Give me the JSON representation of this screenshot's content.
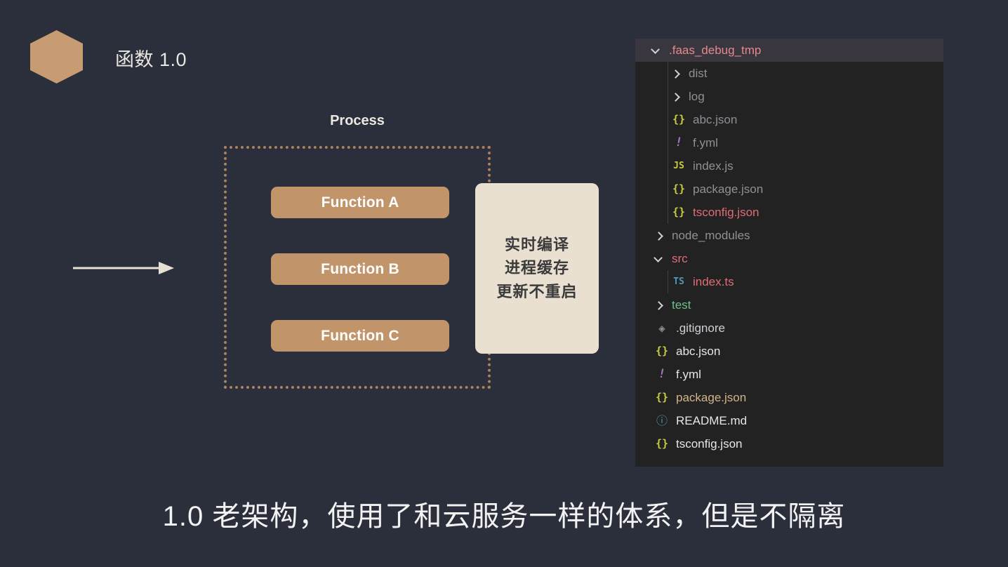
{
  "slide": {
    "title": "函数 1.0",
    "caption": "1.0 老架构，使用了和云服务一样的体系，但是不隔离",
    "background_color": "#2b2e3b",
    "accent_color": "#c79c72"
  },
  "diagram": {
    "process_label": "Process",
    "arrow_name": "right-arrow",
    "functions": [
      {
        "label": "Function A"
      },
      {
        "label": "Function B"
      },
      {
        "label": "Function C"
      }
    ],
    "feature_card": {
      "lines": [
        "实时编译",
        "进程缓存",
        "更新不重启"
      ],
      "background_color": "#e9e0d1"
    },
    "box_border_color": "#a9815a"
  },
  "file_tree": {
    "panel_background": "#222222",
    "header_background": "#3a3640",
    "rows": [
      {
        "label": ".faas_debug_tmp",
        "icon": "chevron-down-icon",
        "indent": 0,
        "color": "red",
        "header": true,
        "guide": false
      },
      {
        "label": "dist",
        "icon": "chevron-right-icon",
        "indent": 1,
        "color": "dim",
        "header": false,
        "guide": true
      },
      {
        "label": "log",
        "icon": "chevron-right-icon",
        "indent": 1,
        "color": "dim",
        "header": false,
        "guide": true
      },
      {
        "label": "abc.json",
        "icon": "json-icon",
        "indent": 1,
        "color": "dim",
        "header": false,
        "guide": true
      },
      {
        "label": "f.yml",
        "icon": "yaml-icon",
        "indent": 1,
        "color": "dim",
        "header": false,
        "guide": true
      },
      {
        "label": "index.js",
        "icon": "js-icon",
        "indent": 1,
        "color": "dim",
        "header": false,
        "guide": true
      },
      {
        "label": "package.json",
        "icon": "json-icon",
        "indent": 1,
        "color": "dim",
        "header": false,
        "guide": true
      },
      {
        "label": "tsconfig.json",
        "icon": "json-icon",
        "indent": 1,
        "color": "red",
        "header": false,
        "guide": true
      },
      {
        "label": "node_modules",
        "icon": "chevron-right-icon",
        "indent": 0,
        "color": "dim",
        "header": false,
        "guide": false
      },
      {
        "label": "src",
        "icon": "chevron-down-icon",
        "indent": 0,
        "color": "red",
        "header": false,
        "guide": false
      },
      {
        "label": "index.ts",
        "icon": "ts-icon",
        "indent": 1,
        "color": "red",
        "header": false,
        "guide": true
      },
      {
        "label": "test",
        "icon": "chevron-right-icon",
        "indent": 0,
        "color": "green",
        "header": false,
        "guide": false
      },
      {
        "label": ".gitignore",
        "icon": "git-icon",
        "indent": 0,
        "color": "plain",
        "header": false,
        "guide": false
      },
      {
        "label": "abc.json",
        "icon": "json-icon",
        "indent": 0,
        "color": "white",
        "header": false,
        "guide": false
      },
      {
        "label": "f.yml",
        "icon": "yaml-icon",
        "indent": 0,
        "color": "white",
        "header": false,
        "guide": false
      },
      {
        "label": "package.json",
        "icon": "json-icon",
        "indent": 0,
        "color": "tan",
        "header": false,
        "guide": false
      },
      {
        "label": "README.md",
        "icon": "info-icon",
        "indent": 0,
        "color": "white",
        "header": false,
        "guide": false
      },
      {
        "label": "tsconfig.json",
        "icon": "json-icon",
        "indent": 0,
        "color": "white",
        "header": false,
        "guide": false
      }
    ]
  }
}
